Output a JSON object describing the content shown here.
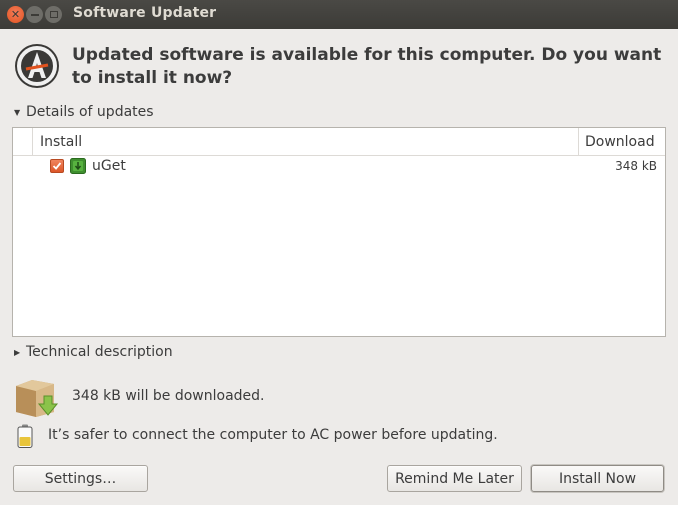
{
  "window": {
    "title": "Software Updater",
    "controls": [
      "close-icon",
      "minimize-icon",
      "maximize-icon"
    ]
  },
  "header": {
    "icon": "software-updater-icon",
    "message": "Updated software is available for this computer. Do you want to install it now?"
  },
  "details_expander": {
    "label": "Details of updates",
    "expanded": true
  },
  "updates_table": {
    "columns": [
      "Install",
      "Download"
    ],
    "rows": [
      {
        "name": "uGet",
        "size": "348 kB",
        "checked": true,
        "icon": "package-icon"
      }
    ]
  },
  "technical_expander": {
    "label": "Technical description",
    "expanded": false
  },
  "download_info": {
    "icon": "download-box-icon",
    "text": "348 kB will be downloaded."
  },
  "power_info": {
    "icon": "battery-icon",
    "text": "It’s safer to connect the computer to AC power before updating."
  },
  "buttons": {
    "settings": "Settings…",
    "remind": "Remind Me Later",
    "install": "Install Now"
  },
  "colors": {
    "titlebar": "#3c3b37",
    "close_button": "#e1531f",
    "checkbox": "#dd5628",
    "window_bg": "#edebe9"
  }
}
